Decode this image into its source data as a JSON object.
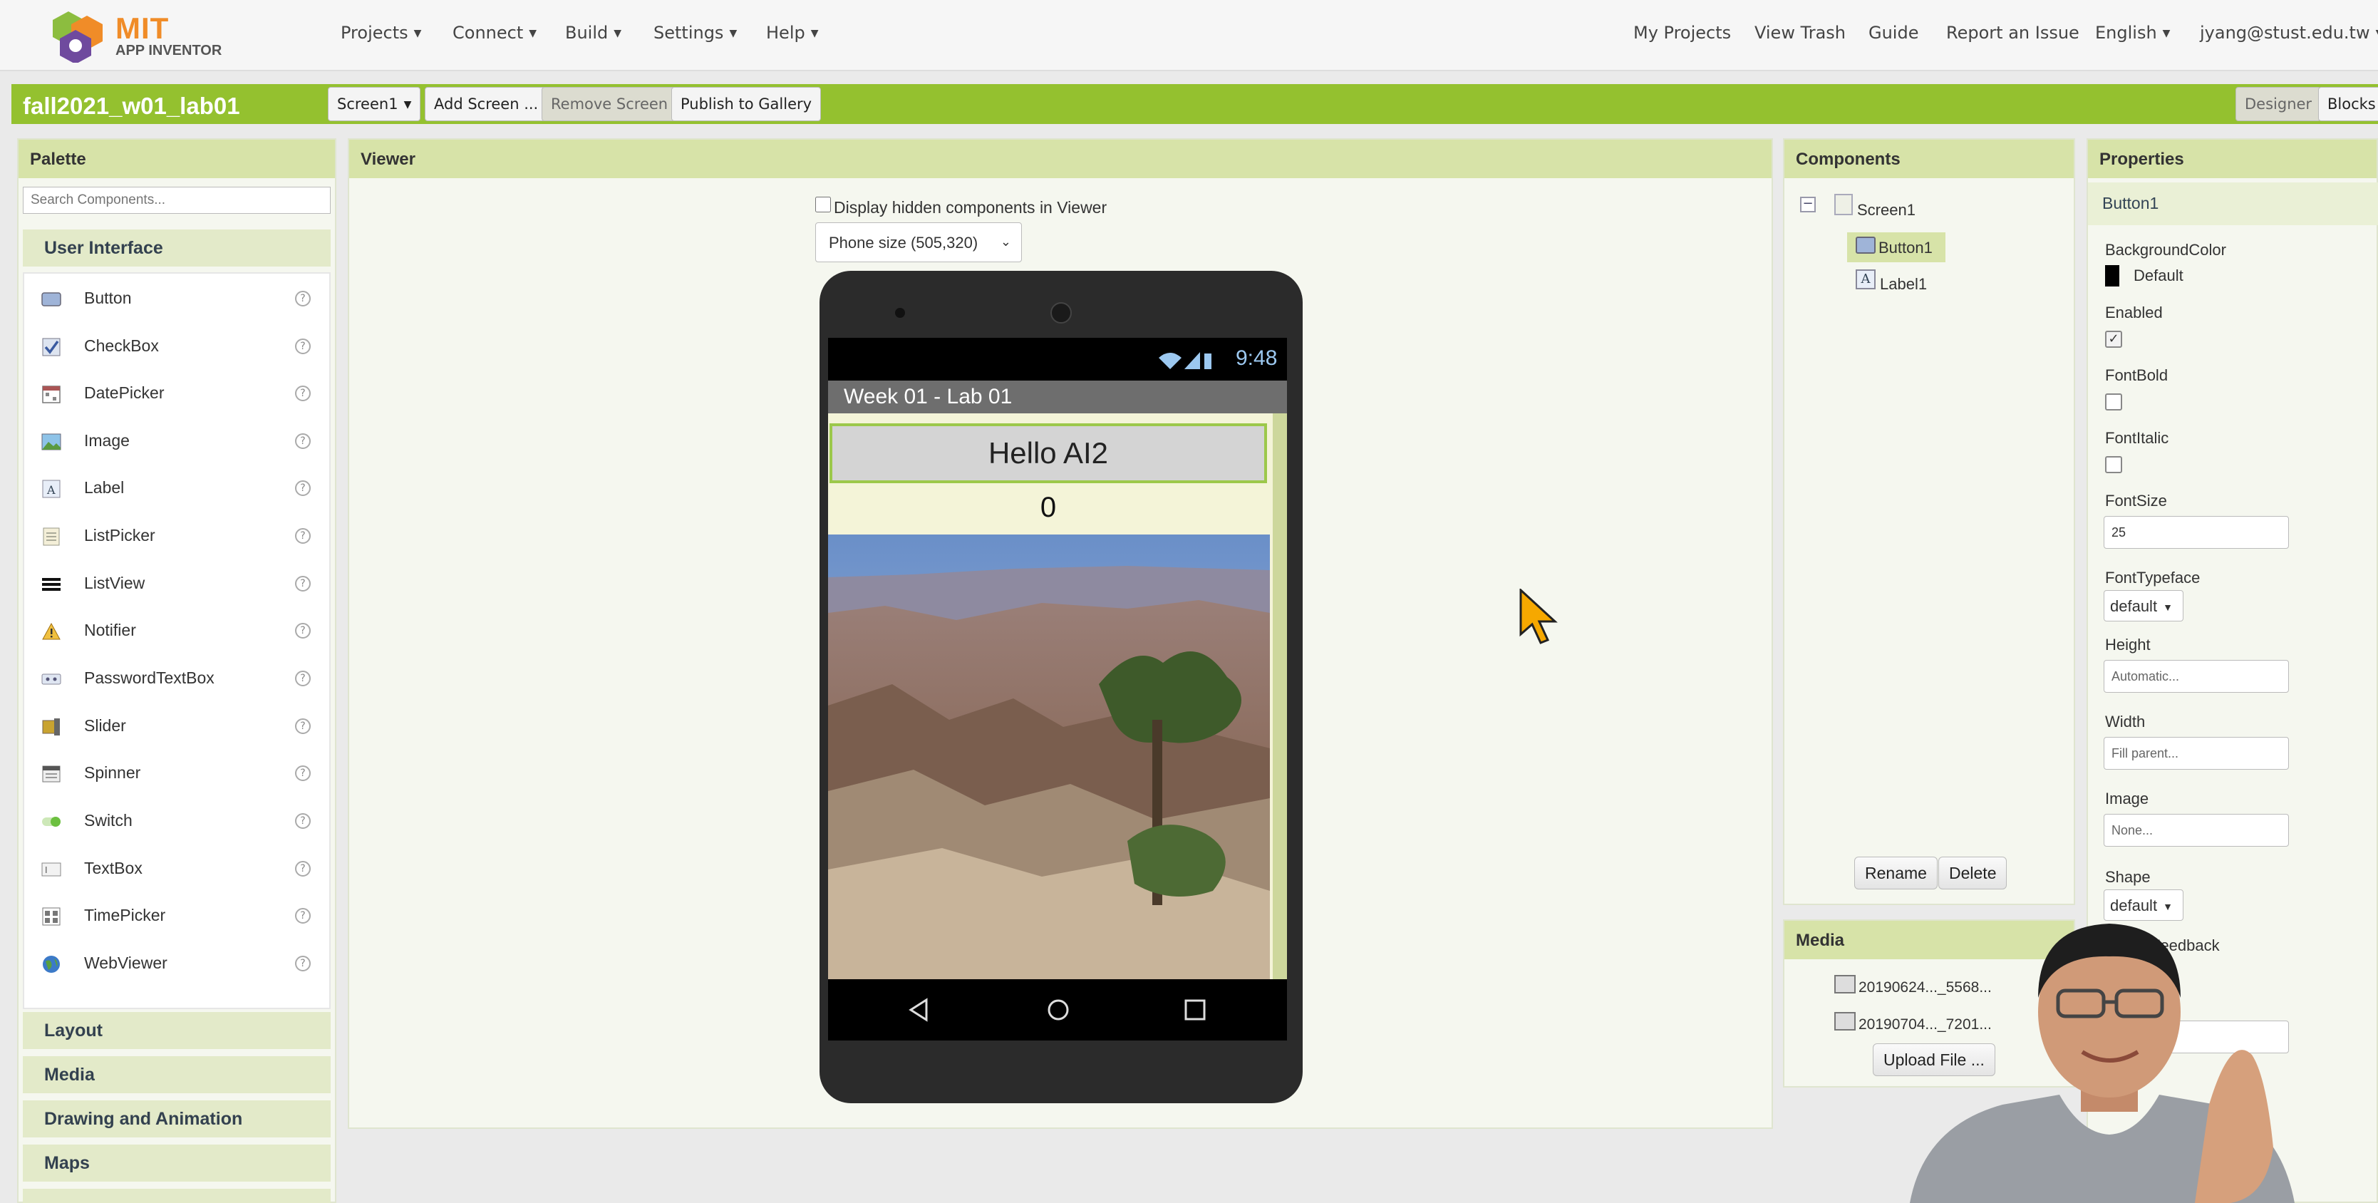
{
  "topbar": {
    "logo_mit": "MIT",
    "logo_sub": "APP INVENTOR",
    "menus": [
      "Projects",
      "Connect",
      "Build",
      "Settings",
      "Help"
    ],
    "links": [
      "My Projects",
      "View Trash",
      "Guide",
      "Report an Issue"
    ],
    "language": "English",
    "user": "jyang@stust.edu.tw"
  },
  "toolbar": {
    "project_name": "fall2021_w01_lab01",
    "screen_select": "Screen1",
    "add_screen": "Add Screen ...",
    "remove_screen": "Remove Screen",
    "publish": "Publish to Gallery",
    "designer": "Designer",
    "blocks": "Blocks"
  },
  "palette": {
    "title": "Palette",
    "search_placeholder": "Search Components...",
    "category_open": "User Interface",
    "items": [
      "Button",
      "CheckBox",
      "DatePicker",
      "Image",
      "Label",
      "ListPicker",
      "ListView",
      "Notifier",
      "PasswordTextBox",
      "Slider",
      "Spinner",
      "Switch",
      "TextBox",
      "TimePicker",
      "WebViewer"
    ],
    "help_glyph": "?",
    "categories": [
      "Layout",
      "Media",
      "Drawing and Animation",
      "Maps"
    ]
  },
  "viewer": {
    "title": "Viewer",
    "hidden_label": "Display hidden components in Viewer",
    "phone_size": "Phone size (505,320)",
    "status_time": "9:48",
    "app_title": "Week 01 - Lab 01",
    "button_text": "Hello AI2",
    "label_text": "0"
  },
  "components": {
    "title": "Components",
    "tree": [
      "Screen1",
      "Button1",
      "Label1"
    ],
    "collapse_glyph": "−",
    "rename": "Rename",
    "delete": "Delete"
  },
  "media": {
    "title": "Media",
    "files": [
      "20190624..._5568...",
      "20190704..._7201..."
    ],
    "upload": "Upload File ..."
  },
  "properties": {
    "title": "Properties",
    "component": "Button1",
    "background_color_label": "BackgroundColor",
    "background_color_value": "Default",
    "enabled_label": "Enabled",
    "fontbold_label": "FontBold",
    "fontitalic_label": "FontItalic",
    "fontsize_label": "FontSize",
    "fontsize_value": "25",
    "fonttypeface_label": "FontTypeface",
    "fonttypeface_value": "default",
    "height_label": "Height",
    "height_value": "Automatic...",
    "width_label": "Width",
    "width_value": "Fill parent...",
    "image_label": "Image",
    "image_value": "None...",
    "shape_label": "Shape",
    "shape_value": "default",
    "feedback_label": "Feedback",
    "partial_value": "2"
  },
  "colors": {
    "brand_green": "#94c12f",
    "panel_header": "#d7e3a8",
    "logo_orange": "#f08c28"
  }
}
